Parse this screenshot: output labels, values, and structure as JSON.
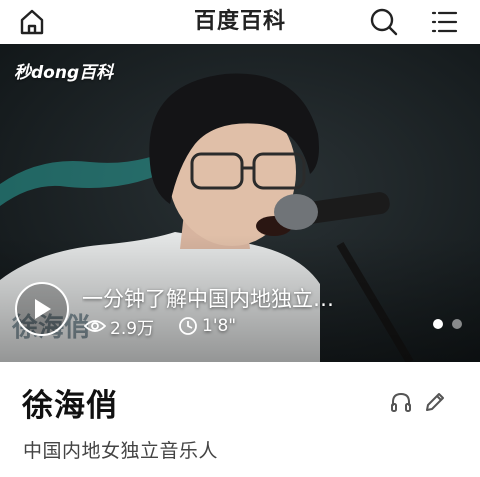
{
  "header": {
    "title": "百度百科",
    "home_icon": "home-icon",
    "search_icon": "search-icon",
    "menu_icon": "menu-icon"
  },
  "video": {
    "watermark": "秒dong百科",
    "title": "一分钟了解中国内地独立…",
    "views": "2.9万",
    "duration": "1'8\"",
    "play_icon": "play-icon",
    "views_icon": "eye-icon",
    "duration_icon": "clock-icon",
    "carousel": {
      "total": 2,
      "active_index": 0
    }
  },
  "entry": {
    "name": "徐海俏",
    "description": "中国内地女独立音乐人",
    "listen_icon": "headphones-icon",
    "edit_icon": "pencil-icon"
  },
  "colors": {
    "text_primary": "#222222",
    "text_secondary": "#444444",
    "icon_gray": "#555555",
    "overlay_white": "#ffffff"
  }
}
